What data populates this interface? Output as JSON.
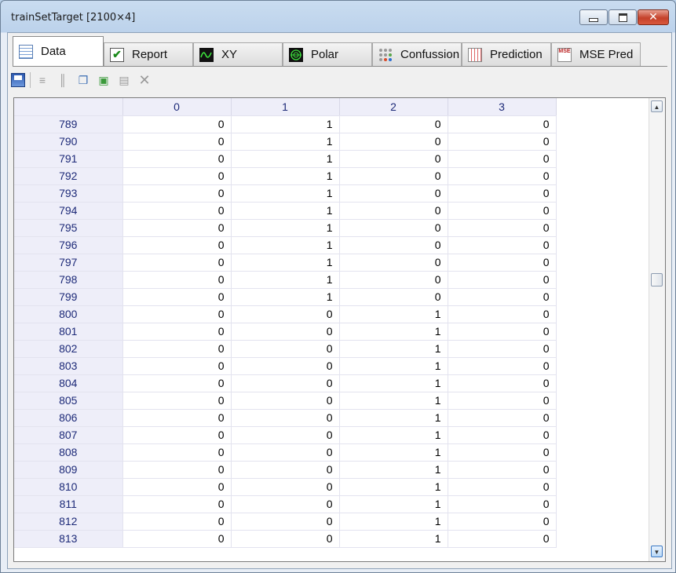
{
  "window": {
    "title": "trainSetTarget [2100×4]"
  },
  "tabs": [
    {
      "label": "Data",
      "icon": "table-icon"
    },
    {
      "label": "Report",
      "icon": "checkmark-icon"
    },
    {
      "label": "XY",
      "icon": "wave-chart-icon"
    },
    {
      "label": "Polar",
      "icon": "polar-chart-icon"
    },
    {
      "label": "Confussion",
      "icon": "dots-matrix-icon"
    },
    {
      "label": "Prediction",
      "icon": "grid-chart-icon"
    },
    {
      "label": "MSE Pred",
      "icon": "mse-icon"
    }
  ],
  "mse_icon_text": "MSE",
  "toolbar": [
    "save-icon",
    "add-row-icon",
    "insert-column-icon",
    "copy-icon",
    "paste-image-icon",
    "paste-icon",
    "delete-icon"
  ],
  "table": {
    "columns": [
      "0",
      "1",
      "2",
      "3"
    ],
    "rows": [
      [
        "789",
        "0",
        "1",
        "0",
        "0"
      ],
      [
        "790",
        "0",
        "1",
        "0",
        "0"
      ],
      [
        "791",
        "0",
        "1",
        "0",
        "0"
      ],
      [
        "792",
        "0",
        "1",
        "0",
        "0"
      ],
      [
        "793",
        "0",
        "1",
        "0",
        "0"
      ],
      [
        "794",
        "0",
        "1",
        "0",
        "0"
      ],
      [
        "795",
        "0",
        "1",
        "0",
        "0"
      ],
      [
        "796",
        "0",
        "1",
        "0",
        "0"
      ],
      [
        "797",
        "0",
        "1",
        "0",
        "0"
      ],
      [
        "798",
        "0",
        "1",
        "0",
        "0"
      ],
      [
        "799",
        "0",
        "1",
        "0",
        "0"
      ],
      [
        "800",
        "0",
        "0",
        "1",
        "0"
      ],
      [
        "801",
        "0",
        "0",
        "1",
        "0"
      ],
      [
        "802",
        "0",
        "0",
        "1",
        "0"
      ],
      [
        "803",
        "0",
        "0",
        "1",
        "0"
      ],
      [
        "804",
        "0",
        "0",
        "1",
        "0"
      ],
      [
        "805",
        "0",
        "0",
        "1",
        "0"
      ],
      [
        "806",
        "0",
        "0",
        "1",
        "0"
      ],
      [
        "807",
        "0",
        "0",
        "1",
        "0"
      ],
      [
        "808",
        "0",
        "0",
        "1",
        "0"
      ],
      [
        "809",
        "0",
        "0",
        "1",
        "0"
      ],
      [
        "810",
        "0",
        "0",
        "1",
        "0"
      ],
      [
        "811",
        "0",
        "0",
        "1",
        "0"
      ],
      [
        "812",
        "0",
        "0",
        "1",
        "0"
      ],
      [
        "813",
        "0",
        "0",
        "1",
        "0"
      ]
    ]
  }
}
